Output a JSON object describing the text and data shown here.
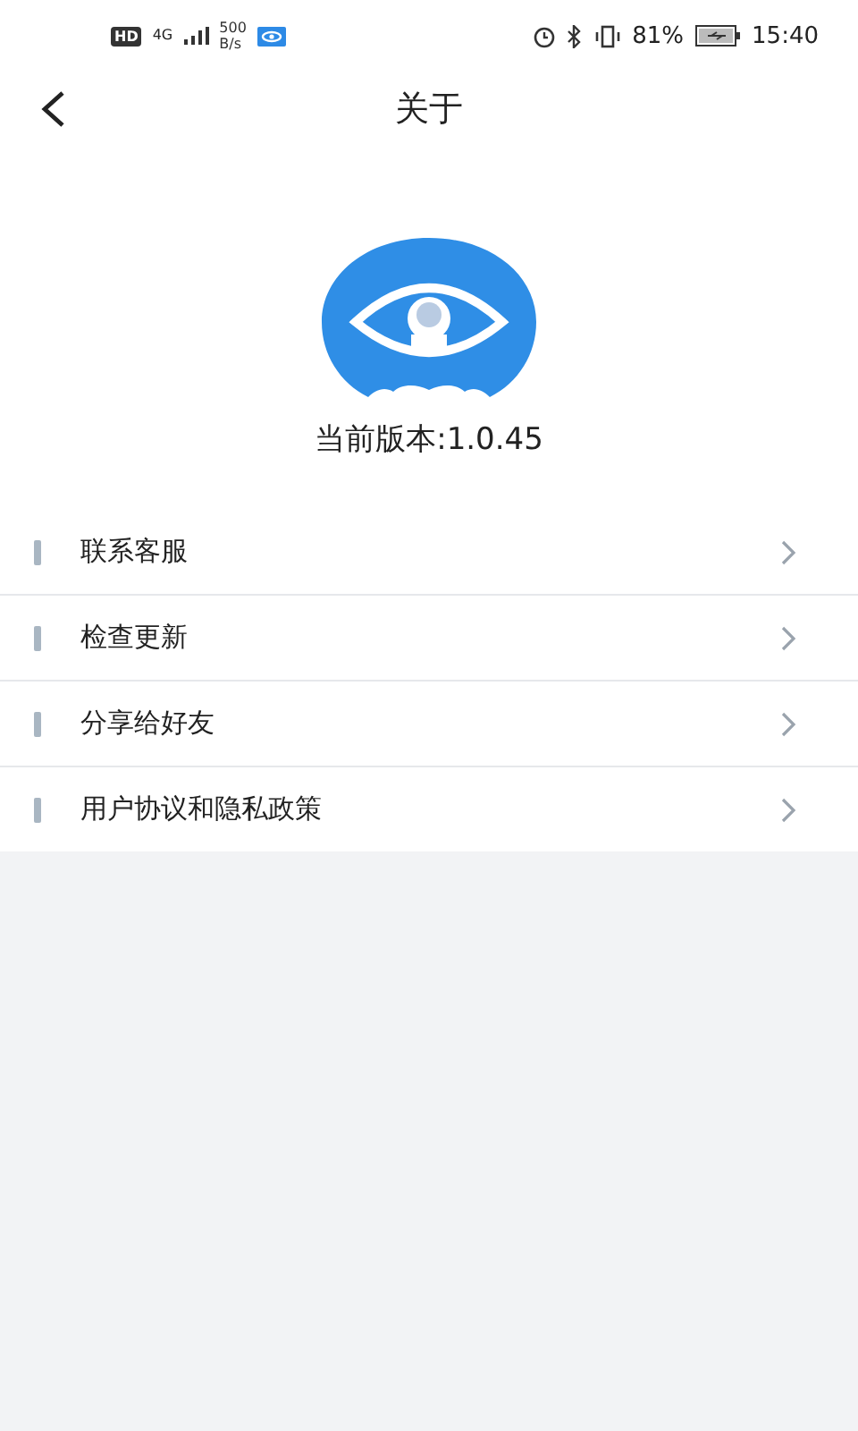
{
  "status_bar": {
    "hd": "HD",
    "network": "4G",
    "speed": [
      "500",
      "B/s"
    ],
    "battery": "81%",
    "time": "15:40"
  },
  "header": {
    "title": "关于"
  },
  "app": {
    "version": "当前版本:1.0.45"
  },
  "menu": [
    {
      "label": "联系客服"
    },
    {
      "label": "检查更新"
    },
    {
      "label": "分享给好友"
    },
    {
      "label": "用户协议和隐私政策"
    }
  ]
}
